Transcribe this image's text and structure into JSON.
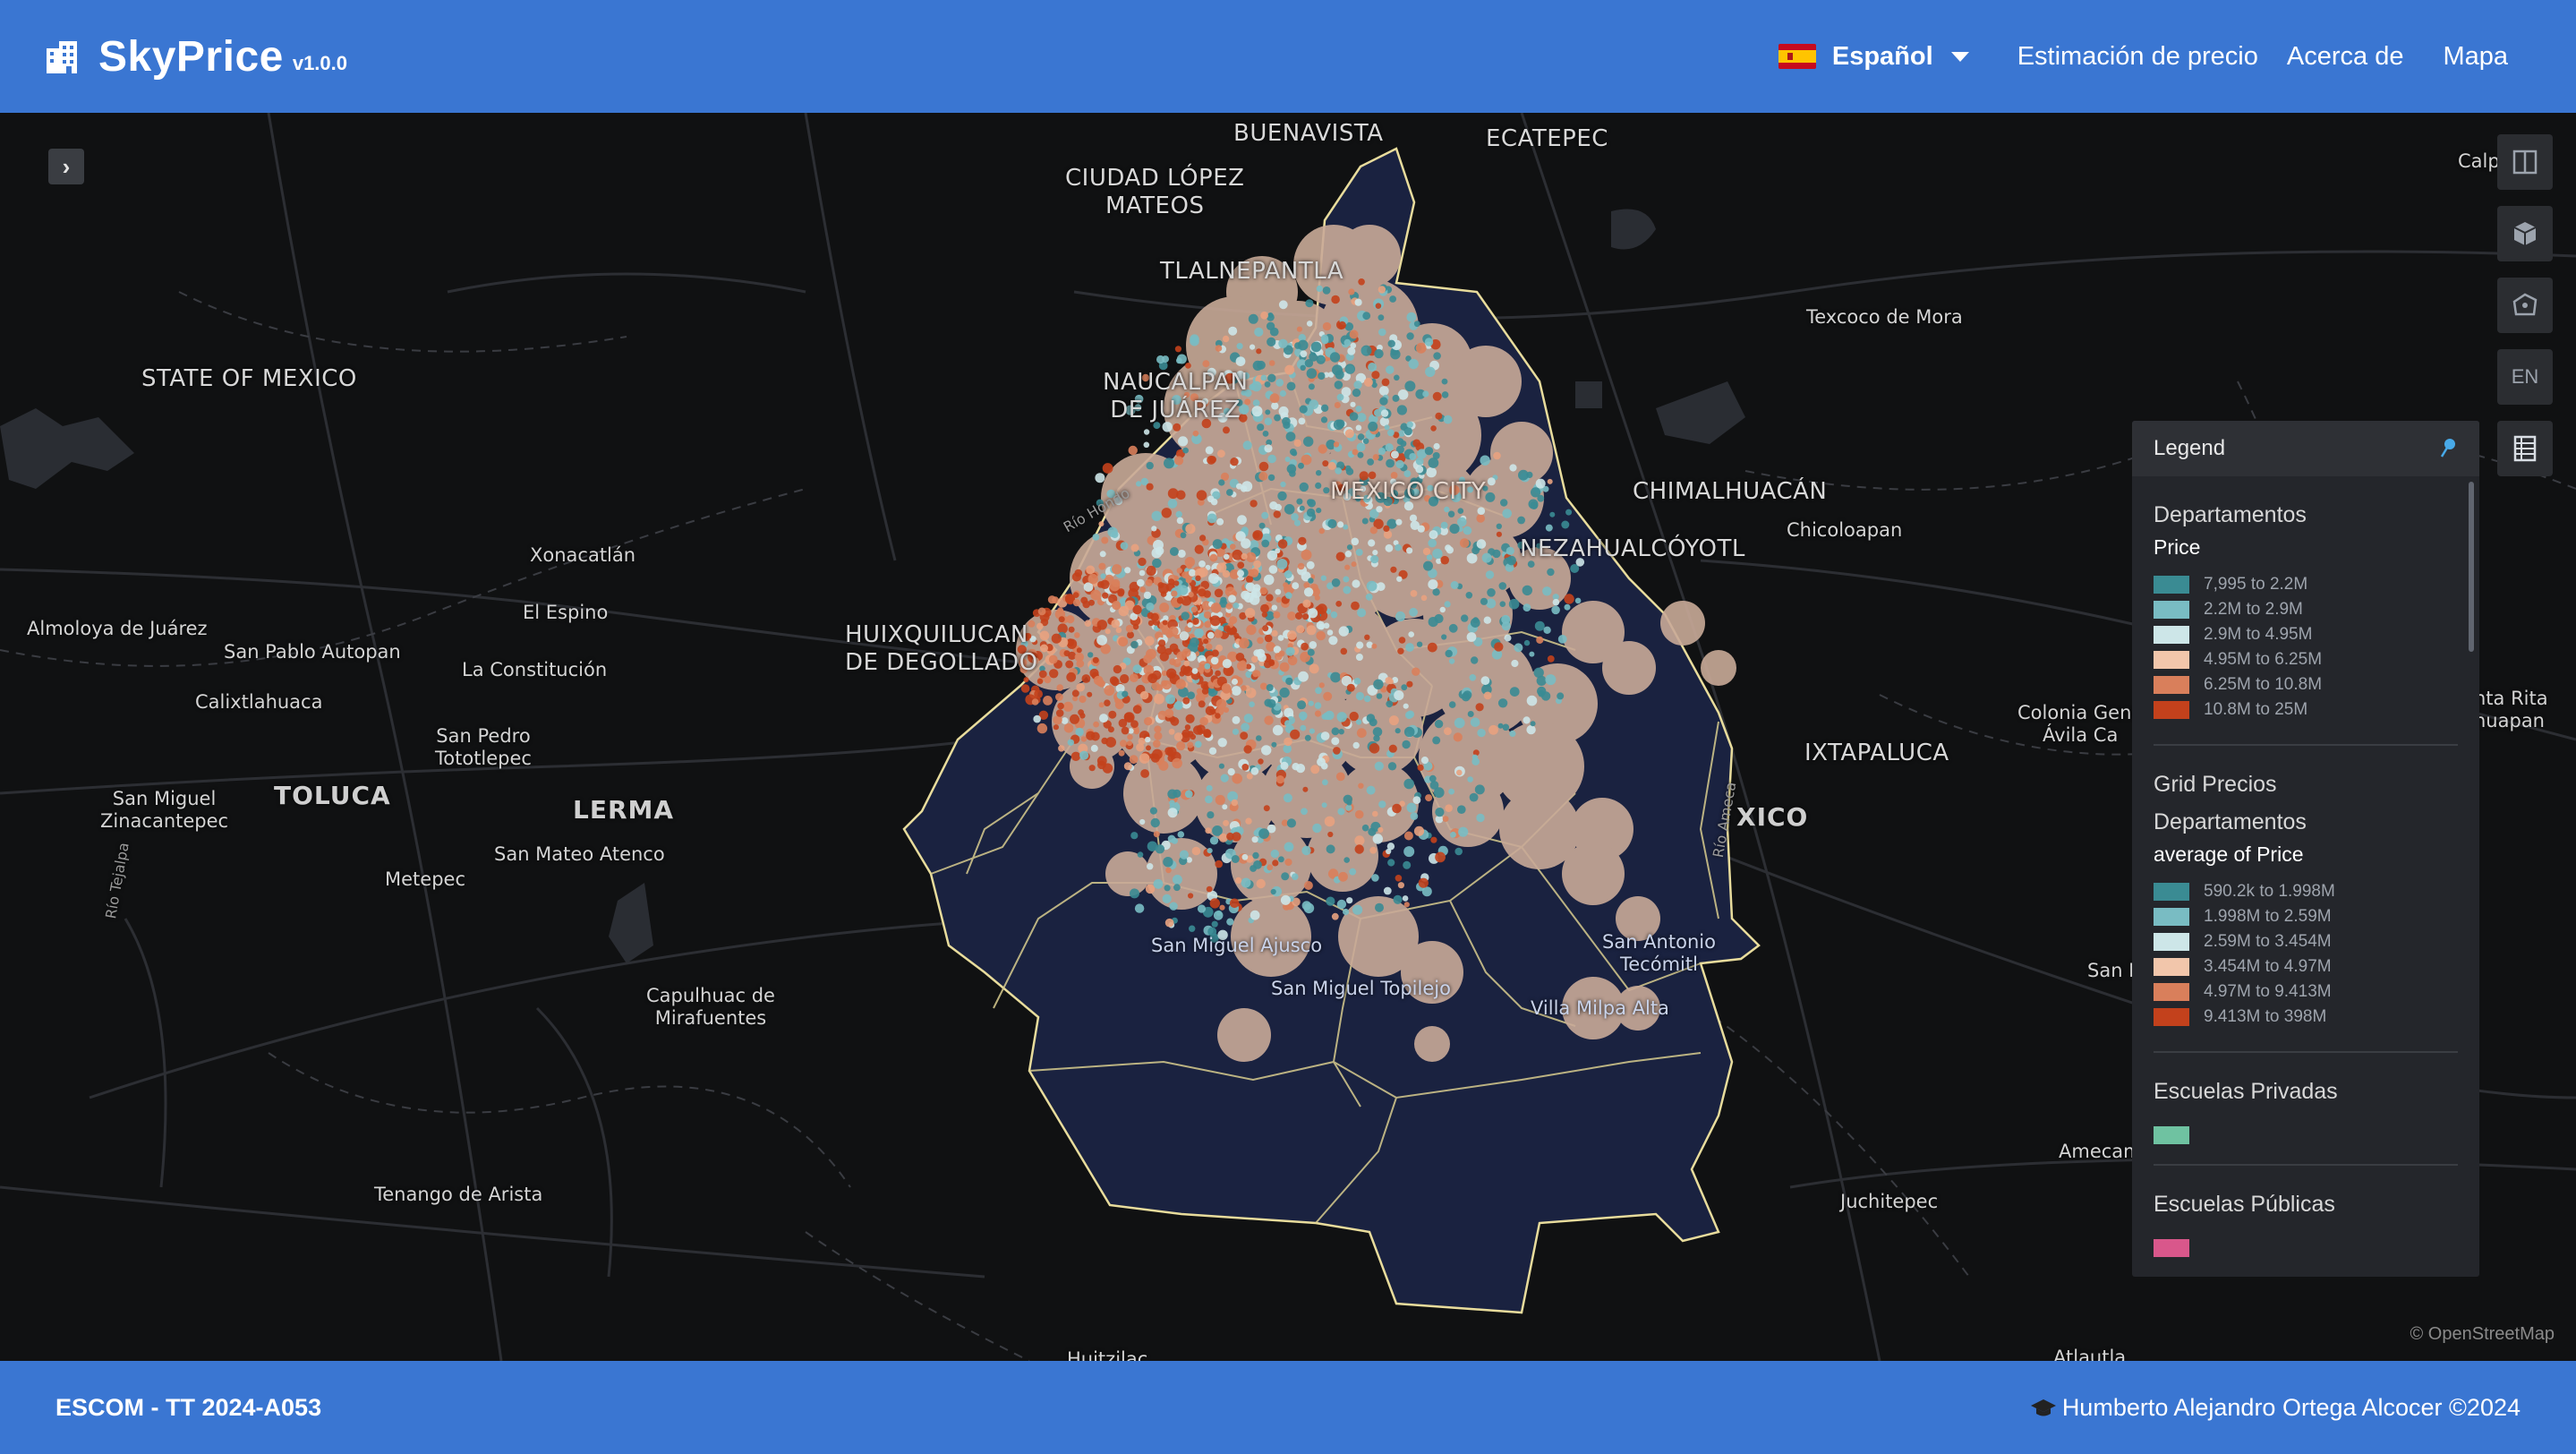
{
  "navbar": {
    "brand_name": "SkyPrice",
    "brand_version": "v1.0.0",
    "brand_icon": "building-icon",
    "language": "Español",
    "links": [
      "Estimación de precio",
      "Acerca de",
      "Mapa"
    ]
  },
  "map": {
    "collapse_icon": "chevron-right-icon",
    "places": {
      "buenavista": "BUENAVISTA",
      "ecatepec": "ECATEPEC",
      "ciudad_lopez_mateos": "CIUDAD LÓPEZ\nMATEOS",
      "tlalnepantla": "TLALNEPANTLA",
      "texcoco": "Texcoco de Mora",
      "state_of_mexico": "STATE OF MEXICO",
      "naucalpan": "NAUCALPAN\nDE JUÁREZ",
      "chimalhuacan": "CHIMALHUACÁN",
      "chicoloapan": "Chicoloapan",
      "nezahualcoyotl": "NEZAHUALCÓYOTL",
      "mexico_city": "MEXICO CITY",
      "xonacatlan": "Xonacatlán",
      "el_espino": "El Espino",
      "almoloya": "Almoloya de Juárez",
      "san_pablo": "San Pablo Autopan",
      "la_constitucion": "La Constitución",
      "huixquilucan": "HUIXQUILUCAN\nDE DEGOLLADO",
      "calixtlahuaca": "Calixtlahuaca",
      "san_pedro": "San Pedro\nTototlepec",
      "toluca": "TOLUCA",
      "lerma": "LERMA",
      "san_miguel_z": "San Miguel\nZinacantepec",
      "san_mateo": "San Mateo Atenco",
      "metepec": "Metepec",
      "ixtapaluca": "IXTAPALUCA",
      "colonia": "Colonia Gene\nÁvila Ca",
      "xico": "XICO",
      "san_miguel_ajusco": "San Miguel Ajusco",
      "san_antonio": "San Antonio\nTecómitl",
      "san_miguel_topilejo": "San Miguel Topilejo",
      "villa_milpa": "Villa Milpa Alta",
      "capulhuac": "Capulhuac de\nMirafuentes",
      "tenango": "Tenango de Arista",
      "juchitepec": "Juchitepec",
      "amecam": "Amecam",
      "san_r": "San R",
      "calpu": "Calpu",
      "santa_rita": "nta Rita\nhuapan",
      "huitzilac": "Huitzilac",
      "atlautla": "Atlautla",
      "rio_hondo": "Río Hondo",
      "rio_amecameca": "Río Ameca",
      "rio_tejalpa": "Río Tejalpa"
    },
    "attribution": "© OpenStreetMap"
  },
  "tools": [
    {
      "name": "split-view-icon",
      "label": ""
    },
    {
      "name": "3d-cube-icon",
      "label": ""
    },
    {
      "name": "draw-polygon-icon",
      "label": ""
    },
    {
      "name": "language-toggle",
      "label": "EN"
    },
    {
      "name": "data-table-icon",
      "label": ""
    }
  ],
  "legend": {
    "title": "Legend",
    "pin_icon": "pin-icon",
    "sections": [
      {
        "layer": "Departamentos",
        "field": "Price",
        "items": [
          {
            "label": "7,995 to 2.2M",
            "color": "#3a8b93"
          },
          {
            "label": "2.2M to 2.9M",
            "color": "#79bcc3"
          },
          {
            "label": "2.9M to 4.95M",
            "color": "#cde6e8"
          },
          {
            "label": "4.95M to 6.25M",
            "color": "#f2c6ab"
          },
          {
            "label": "6.25M to 10.8M",
            "color": "#d97f5b"
          },
          {
            "label": "10.8M to 25M",
            "color": "#c3411c"
          }
        ]
      },
      {
        "layer": "Grid Precios\nDepartamentos",
        "field": "average of Price",
        "items": [
          {
            "label": "590.2k to 1.998M",
            "color": "#3a8b93"
          },
          {
            "label": "1.998M to 2.59M",
            "color": "#79bcc3"
          },
          {
            "label": "2.59M to 3.454M",
            "color": "#cde6e8"
          },
          {
            "label": "3.454M to 4.97M",
            "color": "#f2c6ab"
          },
          {
            "label": "4.97M to 9.413M",
            "color": "#d97f5b"
          },
          {
            "label": "9.413M to 398M",
            "color": "#c3411c"
          }
        ]
      },
      {
        "layer": "Escuelas Privadas",
        "field": "",
        "items": [
          {
            "label": "",
            "color": "#6fc2a1"
          }
        ]
      },
      {
        "layer": "Escuelas Públicas",
        "field": "",
        "items": [
          {
            "label": "",
            "color": "#d9578b"
          }
        ]
      }
    ]
  },
  "footer": {
    "left": "ESCOM - TT 2024-A053",
    "right_icon": "graduation-cap-icon",
    "right": "Humberto Alejandro Ortega Alcocer ©2024"
  },
  "colors": {
    "brand_blue": "#3a76d2",
    "map_bg": "#101112",
    "polygon_fill": "#1a2240",
    "polygon_stroke": "#e8dc9c",
    "heat_blob": "#c9aa98"
  }
}
